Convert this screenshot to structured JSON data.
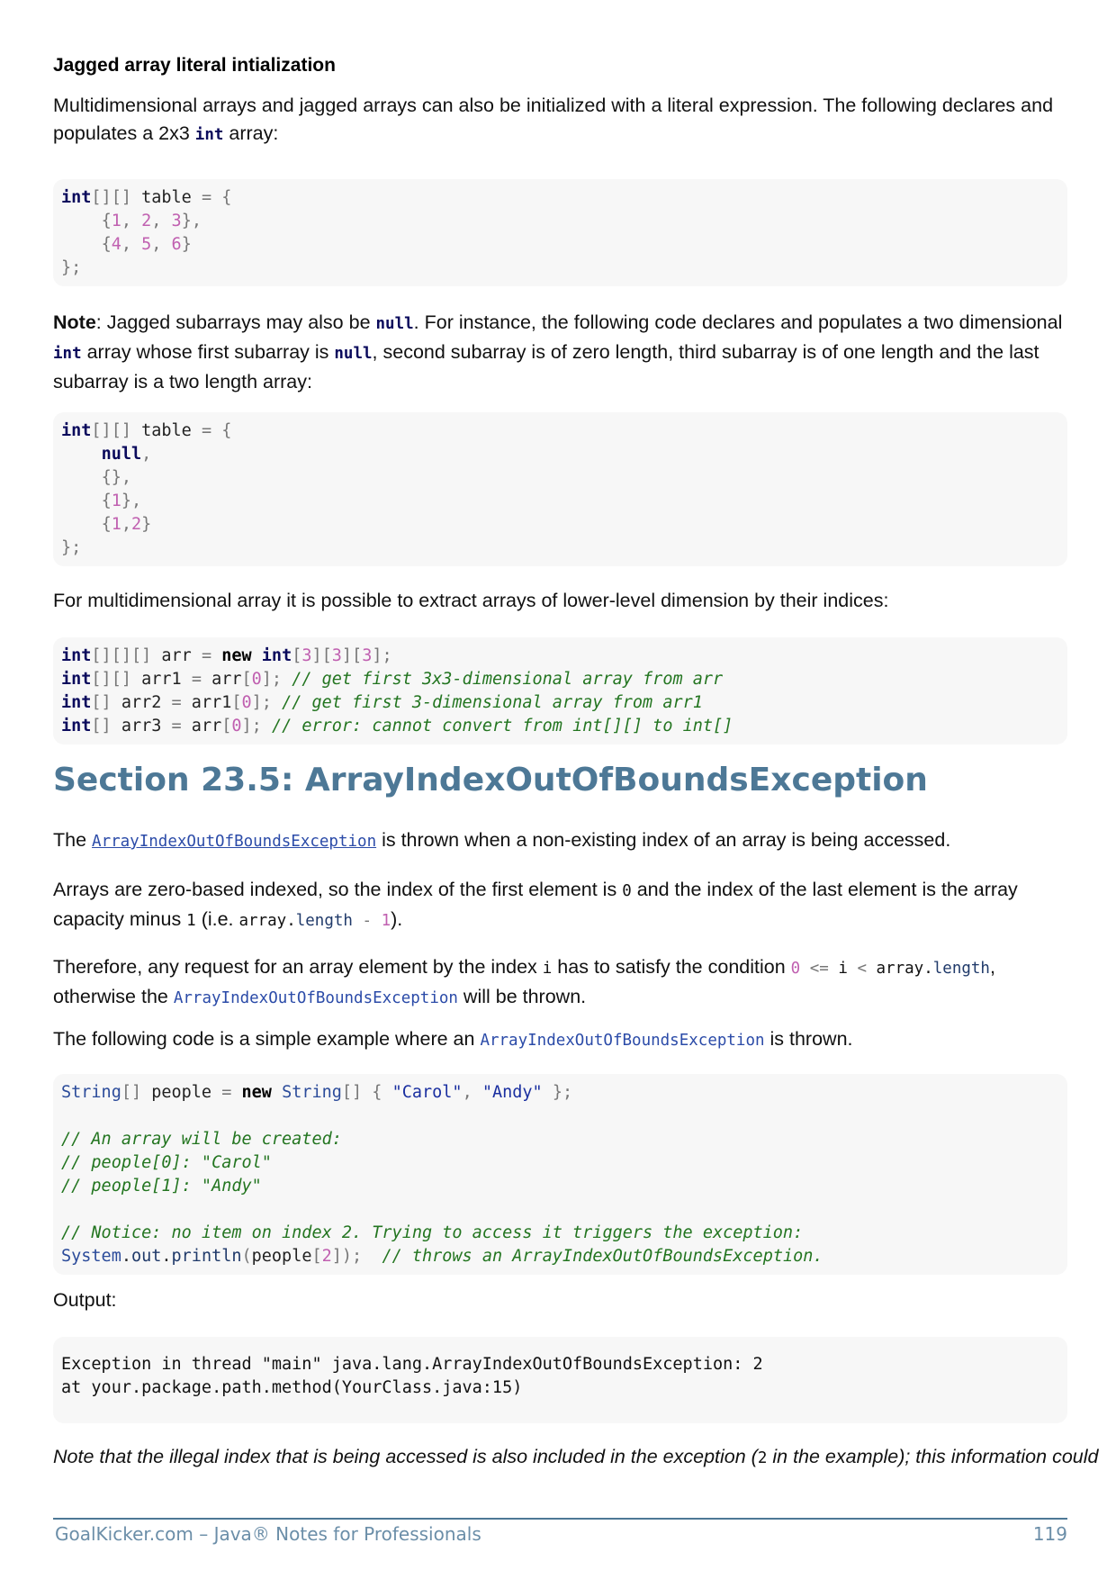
{
  "heading": "Jagged array literal intialization",
  "p1": {
    "a": "Multidimensional arrays and jagged arrays can also be initialized with a literal expression. The following declares and populates a 2x3 ",
    "code": "int",
    "b": " array:"
  },
  "code1": [
    "int[][] table = {",
    "    {1, 2, 3},",
    "    {4, 5, 6}",
    "};"
  ],
  "note": {
    "label": "Note",
    "a": ": Jagged subarrays may also be ",
    "null1": "null",
    "b": ". For instance, the following code declares and populates a two dimensional ",
    "int": "int",
    "c": " array whose first subarray is ",
    "null2": "null",
    "d": ", second subarray is of zero length, third subarray is of one length and the last subarray is a two length array:"
  },
  "code2": [
    "int[][] table = {",
    "    null,",
    "    {},",
    "    {1},",
    "    {1,2}",
    "};"
  ],
  "p3": "For multidimensional array it is possible to extract arrays of lower-level dimension by their indices:",
  "code3": [
    "int[][][] arr = new int[3][3][3];",
    "int[][] arr1 = arr[0]; // get first 3x3-dimensional array from arr",
    "int[] arr2 = arr1[0]; // get first 3-dimensional array from arr1",
    "int[] arr3 = arr[0]; // error: cannot convert from int[][] to int[]"
  ],
  "section_title": "Section 23.5: ArrayIndexOutOfBoundsException",
  "p4": {
    "a": "The ",
    "link": "ArrayIndexOutOfBoundsException",
    "b": " is thrown when a non-existing index of an array is being accessed."
  },
  "p5": {
    "a": "Arrays are zero-based indexed, so the index of the first element is ",
    "zero": "0",
    "b": " and the index of the last element is the array capacity minus ",
    "one": "1",
    "c": " (i.e. ",
    "expr": "array.length - 1",
    "d": ")."
  },
  "p6": {
    "a": "Therefore, any request for an array element by the index ",
    "i": "i",
    "b": " has to satisfy the condition ",
    "cond": "0 <= i < array.length",
    "c": ", otherwise the ",
    "exc": "ArrayIndexOutOfBoundsException",
    "d": " will be thrown."
  },
  "p7": {
    "a": "The following code is a simple example where an ",
    "exc": "ArrayIndexOutOfBoundsException",
    "b": " is thrown."
  },
  "code4": [
    "String[] people = new String[] { \"Carol\", \"Andy\" };",
    "",
    "// An array will be created:",
    "// people[0]: \"Carol\"",
    "// people[1]: \"Andy\"",
    "",
    "// Notice: no item on index 2. Trying to access it triggers the exception:",
    "System.out.println(people[2]);  // throws an ArrayIndexOutOfBoundsException."
  ],
  "output_label": "Output:",
  "output_lines": [
    "Exception in thread \"main\" java.lang.ArrayIndexOutOfBoundsException: 2",
    "at your.package.path.method(YourClass.java:15)"
  ],
  "final_note": {
    "a": "Note that the illegal index that is being accessed is also included in the exception (",
    "num": "2",
    "b": " in the example); this information could"
  },
  "footer": {
    "left": "GoalKicker.com – Java® Notes for Professionals",
    "page": "119"
  }
}
